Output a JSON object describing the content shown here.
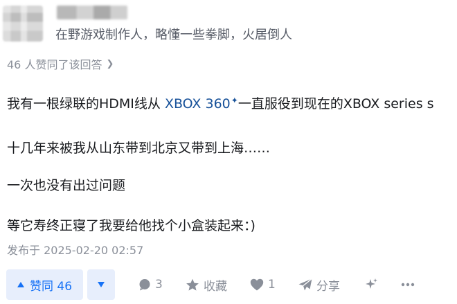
{
  "author": {
    "bio": "在野游戏制作人，略懂一些拳脚，火居倒人"
  },
  "approval": {
    "text": "46 人赞同了该回答",
    "chevron": "chevron-right-icon"
  },
  "content": {
    "p1_before": "我有一根绿联的HDMI线从 ",
    "p1_link": "XBOX 360",
    "p1_after": "一直服役到现在的XBOX series s",
    "p2": "十几年来被我从山东带到北京又带到上海……",
    "p3": "一次也没有出过问题",
    "p4": "等它寿终正寝了我要给他找个小盒装起来：)"
  },
  "meta": {
    "published": "发布于 2025-02-20 02:57"
  },
  "actions": {
    "upvote_label": "赞同 46",
    "comment_count": "3",
    "favorite_label": "收藏",
    "like_count": "1",
    "share_label": "分享"
  },
  "colors": {
    "accent": "#1772f6",
    "accent_bg": "#e7eefc",
    "link": "#175199",
    "muted": "#8a8f99",
    "text": "#191b1f"
  }
}
